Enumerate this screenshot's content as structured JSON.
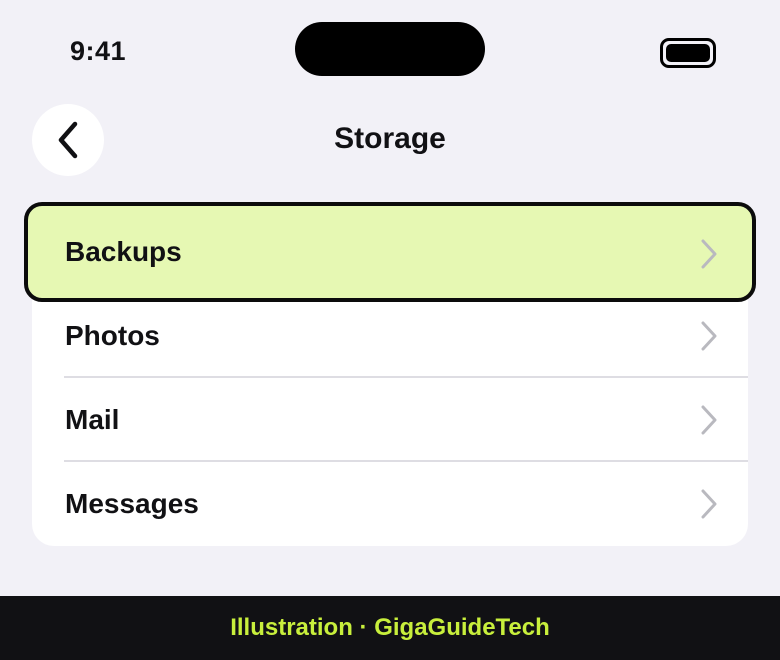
{
  "status_bar": {
    "time": "9:41",
    "battery_icon": "battery-full-icon"
  },
  "header": {
    "title": "Storage",
    "back_icon": "chevron-left-icon"
  },
  "list": {
    "items": [
      {
        "label": "Backups",
        "selected": true,
        "icon": "chevron-right-icon"
      },
      {
        "label": "Photos",
        "selected": false,
        "icon": "chevron-right-icon"
      },
      {
        "label": "Mail",
        "selected": false,
        "icon": "chevron-right-icon"
      },
      {
        "label": "Messages",
        "selected": false,
        "icon": "chevron-right-icon"
      }
    ]
  },
  "footer": {
    "text": "Illustration · GigaGuideTech"
  },
  "colors": {
    "background": "#f2f1f7",
    "selected_fill": "#e6f8b3",
    "selected_border": "#0c0c0c",
    "footer_bg": "#111114",
    "footer_text": "#c8ef3c",
    "chevron": "#b9b9bf"
  }
}
